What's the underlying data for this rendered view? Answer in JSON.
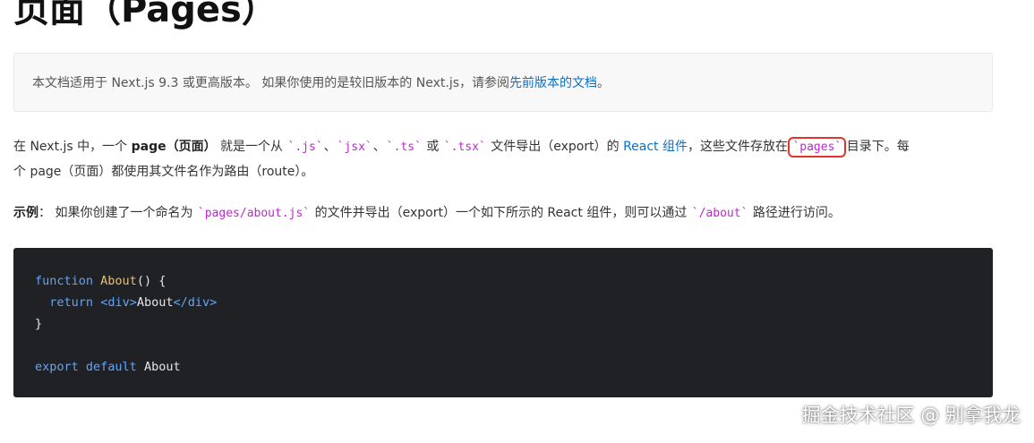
{
  "page": {
    "title": "页面（Pages）"
  },
  "notice": {
    "text": "本文档适用于 Next.js 9.3 或更高版本。 如果你使用的是较旧版本的 Next.js，请参阅 ",
    "link_label": "先前版本的文档",
    "suffix": "。"
  },
  "intro": {
    "t1": "在 Next.js 中，一个 ",
    "bold": "page（页面）",
    "t2": " 就是一个从 ",
    "ext_js": "`.js`",
    "sep1": "、",
    "ext_jsx": "`jsx`",
    "sep2": "、",
    "ext_ts": "`.ts`",
    "or": " 或 ",
    "ext_tsx": "`.tsx`",
    "t3": " 文件导出（export）的 ",
    "react_link": "React 组件",
    "t4": "，这些文件存放在 ",
    "pages_dir": "`pages`",
    "t5": " 目录下。每",
    "line2": "个 page（页面）都使用其文件名作为路由（route）。"
  },
  "example": {
    "label": "示例",
    "t1": "： 如果你创建了一个命名为 ",
    "file": "`pages/about.js`",
    "t2": " 的文件并导出（export）一个如下所示的 React 组件，则可以通过 ",
    "path": "`/about`",
    "t3": " 路径进行访问。"
  },
  "code": {
    "l1_kw": "function",
    "l1_name": "About",
    "l1_rest": "() {",
    "l2_indent": "  ",
    "l2_kw": "return",
    "l2_open": "<div>",
    "l2_text": "About",
    "l2_close": "</div>",
    "l3": "}",
    "l5_kw": "export default",
    "l5_name": "About"
  },
  "watermark": "掘金技术社区 @ 别拿我龙",
  "colors": {
    "link": "#0a72c7",
    "inline_code": "#c026d3",
    "code_bg": "#1f2125",
    "highlight_border": "#e0352b"
  }
}
